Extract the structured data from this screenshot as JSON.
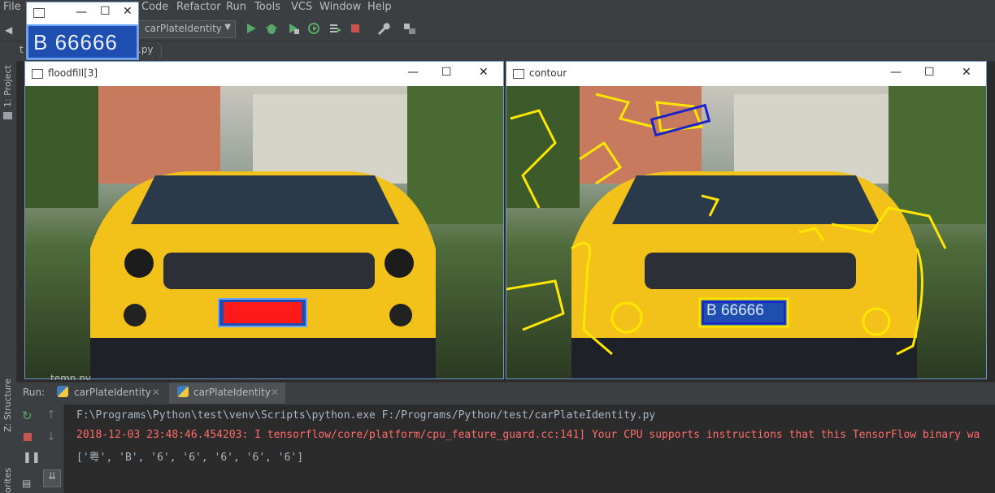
{
  "menu": {
    "items": [
      "File",
      "Code",
      "Refactor",
      "Run",
      "Tools",
      "VCS",
      "Window",
      "Help"
    ]
  },
  "toolbar": {
    "run_config": "carPlateIdentity",
    "icons": [
      "run-icon",
      "debug-icon",
      "coverage-icon",
      "profile-icon",
      "concurrency-icon",
      "stop-icon",
      "wrench-icon",
      "sdk-icon"
    ]
  },
  "nav": {
    "file_tab": ".py",
    "prefix": "t"
  },
  "left_strip": {
    "project_label": "1: Project",
    "structure_label": "Z: Structure",
    "favorites_label": "orites"
  },
  "plate_window": {
    "plate_text": "B 66666"
  },
  "floodfill_window": {
    "title": "floodfill[3]"
  },
  "contour_window": {
    "title": "contour",
    "plate_text": "B 66666"
  },
  "behind_window_text": "temp.py",
  "run_panel": {
    "label": "Run:",
    "tabs": [
      "carPlateIdentity",
      "carPlateIdentity"
    ]
  },
  "console": {
    "lines": [
      {
        "text": "F:\\Programs\\Python\\test\\venv\\Scripts\\python.exe F:/Programs/Python/test/carPlateIdentity.py",
        "color": "#a9b7c6"
      },
      {
        "text": "2018-12-03 23:48:46.454203: I tensorflow/core/platform/cpu_feature_guard.cc:141] Your CPU supports instructions that this TensorFlow binary wa",
        "color": "#ff6b68"
      },
      {
        "text": "['粤', 'B', '6', '6', '6', '6', '6']",
        "color": "#a9b7c6"
      }
    ]
  },
  "colors": {
    "ide_bg": "#2b2b2b",
    "panel_bg": "#3c3f41",
    "error_text": "#ff6b68",
    "plate_blue": "#1e4fb0",
    "contour_yellow": "#ffe600",
    "contour_blue": "#1a24c8",
    "floodfill_red": "#ff1a1a"
  }
}
